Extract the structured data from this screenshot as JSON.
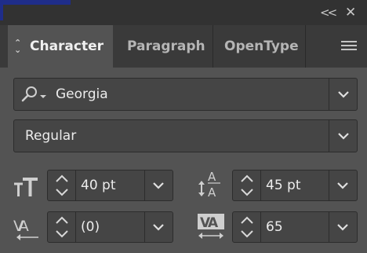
{
  "panel": {
    "collapse_label": "<<",
    "close_label": "✕"
  },
  "tabs": [
    {
      "label": "Character",
      "active": true
    },
    {
      "label": "Paragraph",
      "active": false
    },
    {
      "label": "OpenType",
      "active": false
    }
  ],
  "font": {
    "family": "Georgia",
    "style": "Regular"
  },
  "metrics": {
    "font_size": "40 pt",
    "leading": "45 pt",
    "kerning": "(0)",
    "tracking": "65"
  },
  "icons": {
    "collapse": "double-chevron-left-icon",
    "close": "close-icon",
    "menu": "hamburger-menu-icon",
    "search": "search-icon",
    "font_size": "font-size-icon",
    "leading": "leading-icon",
    "kerning": "kerning-icon",
    "tracking": "tracking-icon"
  },
  "colors": {
    "panel_bg": "#535353",
    "tab_bar_bg": "#3a3a3a",
    "field_bg": "#454545",
    "text": "#ececec"
  }
}
